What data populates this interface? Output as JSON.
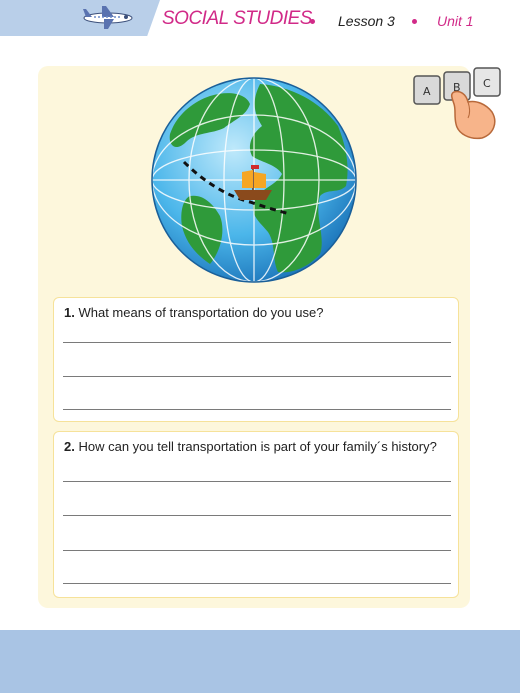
{
  "header": {
    "title": "SOCIAL STUDIES",
    "lesson": "Lesson 3",
    "unit": "Unit 1",
    "accent_color": "#d12a88",
    "band_color": "#b9cfe9"
  },
  "illustrations": {
    "plane": "airplane-icon",
    "globe": "globe-with-ship-route",
    "keys": [
      "A",
      "B",
      "C"
    ]
  },
  "questions": [
    {
      "number": "1.",
      "text": "What means of transportation do you use?"
    },
    {
      "number": "2.",
      "text": "How can you tell transportation is part of your family´s history?"
    }
  ],
  "footer": {
    "band_color": "#a9c4e4"
  }
}
